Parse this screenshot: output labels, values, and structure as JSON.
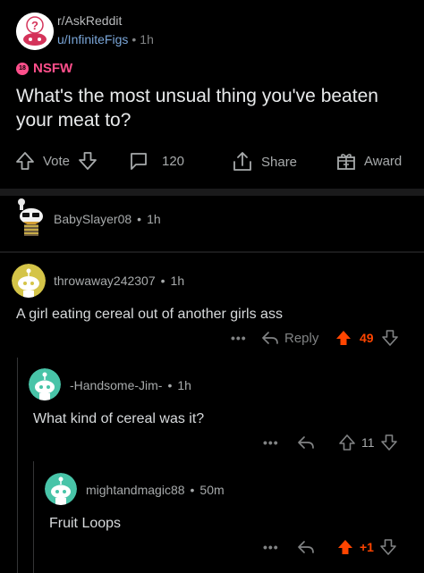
{
  "post": {
    "subreddit": "r/AskReddit",
    "author": "u/InfiniteFigs",
    "time": "1h",
    "nsfw_label": "NSFW",
    "nsfw_badge": "18",
    "title": "What's the most unsual thing you've beaten your meat to?",
    "actions": {
      "vote_label": "Vote",
      "comment_count": "120",
      "share_label": "Share",
      "award_label": "Award"
    }
  },
  "comments": [
    {
      "username": "BabySlayer08",
      "time": "1h",
      "body": "",
      "collapsed": true
    },
    {
      "username": "throwaway242307",
      "time": "1h",
      "body": "A girl eating cereal out of another girls ass",
      "reply_label": "Reply",
      "score": "49",
      "upvoted": true,
      "dots": "•••"
    },
    {
      "username": "-Handsome-Jim-",
      "time": "1h",
      "body": "What kind of cereal was it?",
      "score": "11",
      "upvoted": false,
      "dots": "•••"
    },
    {
      "username": "mightandmagic88",
      "time": "50m",
      "body": "Fruit Loops",
      "score": "+1",
      "upvoted": true,
      "dots": "•••"
    }
  ],
  "colors": {
    "background": "#000000",
    "nsfw": "#ff4f8b",
    "upvote": "#ff4500",
    "author_link": "#7aa6d8",
    "muted": "#818384"
  }
}
